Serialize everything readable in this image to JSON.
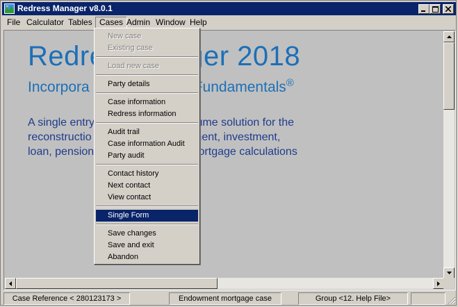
{
  "window": {
    "title": "Redress Manager v8.0.1"
  },
  "menubar": [
    {
      "label": "File"
    },
    {
      "label": "Calculator"
    },
    {
      "label": "Tables"
    },
    {
      "label": "Cases"
    },
    {
      "label": "Admin"
    },
    {
      "label": "Window"
    },
    {
      "label": "Help"
    }
  ],
  "splash": {
    "title_visible_left": "Redre",
    "title_visible_right": "ager 2018",
    "subtitle_left": "Incorpora",
    "subtitle_right": "Fundamentals",
    "subtitle_mark": "®",
    "desc_lines": [
      {
        "left": "A single entry",
        "right": "volume solution for the"
      },
      {
        "left": "reconstructio",
        "right": "owment, investment,"
      },
      {
        "left": "loan, pension",
        "right": "mortgage calculations"
      }
    ]
  },
  "cases_menu": {
    "items": [
      {
        "label": "New case",
        "state": "disabled"
      },
      {
        "label": "Existing case",
        "state": "disabled"
      },
      {
        "label": "Load new case",
        "state": "disabled"
      },
      {
        "label": "Party details",
        "state": "enabled"
      },
      {
        "label": "Case information",
        "state": "enabled"
      },
      {
        "label": "Redress information",
        "state": "enabled"
      },
      {
        "label": "Audit trail",
        "state": "enabled"
      },
      {
        "label": "Case information Audit",
        "state": "enabled"
      },
      {
        "label": "Party audit",
        "state": "enabled"
      },
      {
        "label": "Contact history",
        "state": "enabled"
      },
      {
        "label": "Next contact",
        "state": "enabled"
      },
      {
        "label": "View contact",
        "state": "enabled"
      },
      {
        "label": "Single Form",
        "state": "selected"
      },
      {
        "label": "Save changes",
        "state": "enabled"
      },
      {
        "label": "Save and exit",
        "state": "enabled"
      },
      {
        "label": "Abandon",
        "state": "enabled"
      }
    ]
  },
  "statusbar": {
    "case_reference": "Case Reference < 280123173 >",
    "case_type": "Endowment mortgage case",
    "group": "Group <12. Help File>"
  },
  "colors": {
    "titlebar": "#0a246a",
    "splash_blue": "#1c6fb8",
    "desc_blue": "#1f3c8c",
    "selection": "#0a246a"
  }
}
